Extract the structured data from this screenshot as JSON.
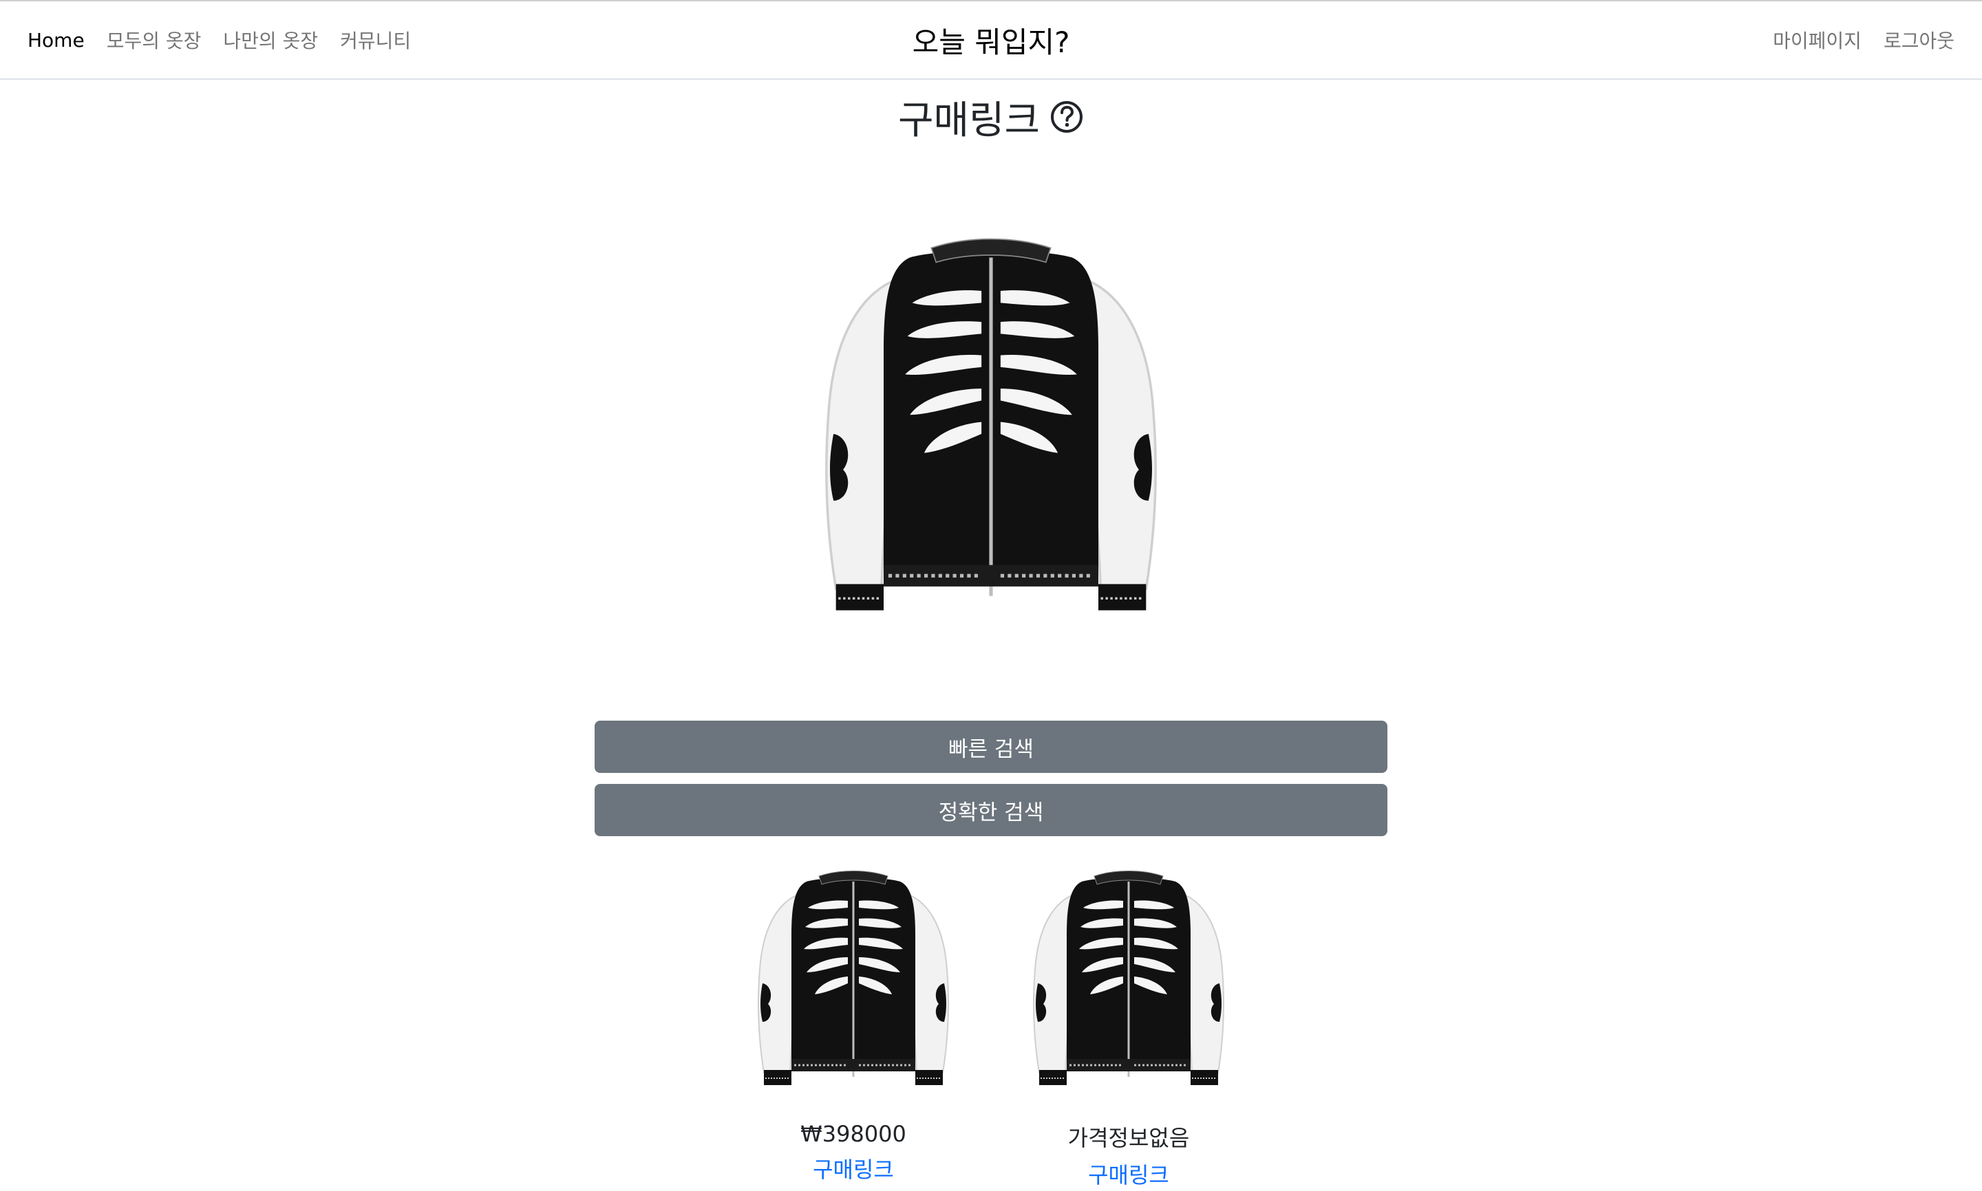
{
  "navbar": {
    "left_links": [
      {
        "label": "Home",
        "active": true
      },
      {
        "label": "모두의 옷장",
        "active": false
      },
      {
        "label": "나만의 옷장",
        "active": false
      },
      {
        "label": "커뮤니티",
        "active": false
      }
    ],
    "brand": "오늘 뭐입지?",
    "right_links": [
      {
        "label": "마이페이지"
      },
      {
        "label": "로그아웃"
      }
    ]
  },
  "heading": {
    "title": "구매링크",
    "icon": "question-circle-icon"
  },
  "main_image": {
    "alt": "black bomber jacket with white rib-cage print and white sleeves",
    "icon": "jacket-image"
  },
  "buttons": {
    "quick_search": "빠른 검색",
    "exact_search": "정확한 검색"
  },
  "results": [
    {
      "price": "₩398000",
      "link": "구매링크"
    },
    {
      "price": "가격정보없음",
      "link": "구매링크"
    }
  ],
  "colors": {
    "button_bg": "#6c757d",
    "link": "#0d6efd",
    "nav_muted": "#8c8c8c"
  }
}
